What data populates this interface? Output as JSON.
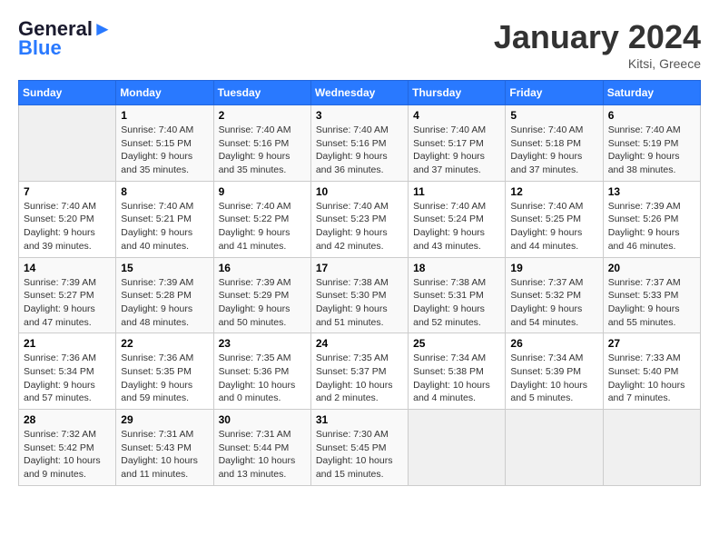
{
  "header": {
    "logo_line1": "General",
    "logo_line2": "Blue",
    "month_title": "January 2024",
    "location": "Kitsi, Greece"
  },
  "days_of_week": [
    "Sunday",
    "Monday",
    "Tuesday",
    "Wednesday",
    "Thursday",
    "Friday",
    "Saturday"
  ],
  "weeks": [
    [
      {
        "day": "",
        "info": ""
      },
      {
        "day": "1",
        "info": "Sunrise: 7:40 AM\nSunset: 5:15 PM\nDaylight: 9 hours\nand 35 minutes."
      },
      {
        "day": "2",
        "info": "Sunrise: 7:40 AM\nSunset: 5:16 PM\nDaylight: 9 hours\nand 35 minutes."
      },
      {
        "day": "3",
        "info": "Sunrise: 7:40 AM\nSunset: 5:16 PM\nDaylight: 9 hours\nand 36 minutes."
      },
      {
        "day": "4",
        "info": "Sunrise: 7:40 AM\nSunset: 5:17 PM\nDaylight: 9 hours\nand 37 minutes."
      },
      {
        "day": "5",
        "info": "Sunrise: 7:40 AM\nSunset: 5:18 PM\nDaylight: 9 hours\nand 37 minutes."
      },
      {
        "day": "6",
        "info": "Sunrise: 7:40 AM\nSunset: 5:19 PM\nDaylight: 9 hours\nand 38 minutes."
      }
    ],
    [
      {
        "day": "7",
        "info": "Sunrise: 7:40 AM\nSunset: 5:20 PM\nDaylight: 9 hours\nand 39 minutes."
      },
      {
        "day": "8",
        "info": "Sunrise: 7:40 AM\nSunset: 5:21 PM\nDaylight: 9 hours\nand 40 minutes."
      },
      {
        "day": "9",
        "info": "Sunrise: 7:40 AM\nSunset: 5:22 PM\nDaylight: 9 hours\nand 41 minutes."
      },
      {
        "day": "10",
        "info": "Sunrise: 7:40 AM\nSunset: 5:23 PM\nDaylight: 9 hours\nand 42 minutes."
      },
      {
        "day": "11",
        "info": "Sunrise: 7:40 AM\nSunset: 5:24 PM\nDaylight: 9 hours\nand 43 minutes."
      },
      {
        "day": "12",
        "info": "Sunrise: 7:40 AM\nSunset: 5:25 PM\nDaylight: 9 hours\nand 44 minutes."
      },
      {
        "day": "13",
        "info": "Sunrise: 7:39 AM\nSunset: 5:26 PM\nDaylight: 9 hours\nand 46 minutes."
      }
    ],
    [
      {
        "day": "14",
        "info": "Sunrise: 7:39 AM\nSunset: 5:27 PM\nDaylight: 9 hours\nand 47 minutes."
      },
      {
        "day": "15",
        "info": "Sunrise: 7:39 AM\nSunset: 5:28 PM\nDaylight: 9 hours\nand 48 minutes."
      },
      {
        "day": "16",
        "info": "Sunrise: 7:39 AM\nSunset: 5:29 PM\nDaylight: 9 hours\nand 50 minutes."
      },
      {
        "day": "17",
        "info": "Sunrise: 7:38 AM\nSunset: 5:30 PM\nDaylight: 9 hours\nand 51 minutes."
      },
      {
        "day": "18",
        "info": "Sunrise: 7:38 AM\nSunset: 5:31 PM\nDaylight: 9 hours\nand 52 minutes."
      },
      {
        "day": "19",
        "info": "Sunrise: 7:37 AM\nSunset: 5:32 PM\nDaylight: 9 hours\nand 54 minutes."
      },
      {
        "day": "20",
        "info": "Sunrise: 7:37 AM\nSunset: 5:33 PM\nDaylight: 9 hours\nand 55 minutes."
      }
    ],
    [
      {
        "day": "21",
        "info": "Sunrise: 7:36 AM\nSunset: 5:34 PM\nDaylight: 9 hours\nand 57 minutes."
      },
      {
        "day": "22",
        "info": "Sunrise: 7:36 AM\nSunset: 5:35 PM\nDaylight: 9 hours\nand 59 minutes."
      },
      {
        "day": "23",
        "info": "Sunrise: 7:35 AM\nSunset: 5:36 PM\nDaylight: 10 hours\nand 0 minutes."
      },
      {
        "day": "24",
        "info": "Sunrise: 7:35 AM\nSunset: 5:37 PM\nDaylight: 10 hours\nand 2 minutes."
      },
      {
        "day": "25",
        "info": "Sunrise: 7:34 AM\nSunset: 5:38 PM\nDaylight: 10 hours\nand 4 minutes."
      },
      {
        "day": "26",
        "info": "Sunrise: 7:34 AM\nSunset: 5:39 PM\nDaylight: 10 hours\nand 5 minutes."
      },
      {
        "day": "27",
        "info": "Sunrise: 7:33 AM\nSunset: 5:40 PM\nDaylight: 10 hours\nand 7 minutes."
      }
    ],
    [
      {
        "day": "28",
        "info": "Sunrise: 7:32 AM\nSunset: 5:42 PM\nDaylight: 10 hours\nand 9 minutes."
      },
      {
        "day": "29",
        "info": "Sunrise: 7:31 AM\nSunset: 5:43 PM\nDaylight: 10 hours\nand 11 minutes."
      },
      {
        "day": "30",
        "info": "Sunrise: 7:31 AM\nSunset: 5:44 PM\nDaylight: 10 hours\nand 13 minutes."
      },
      {
        "day": "31",
        "info": "Sunrise: 7:30 AM\nSunset: 5:45 PM\nDaylight: 10 hours\nand 15 minutes."
      },
      {
        "day": "",
        "info": ""
      },
      {
        "day": "",
        "info": ""
      },
      {
        "day": "",
        "info": ""
      }
    ]
  ]
}
